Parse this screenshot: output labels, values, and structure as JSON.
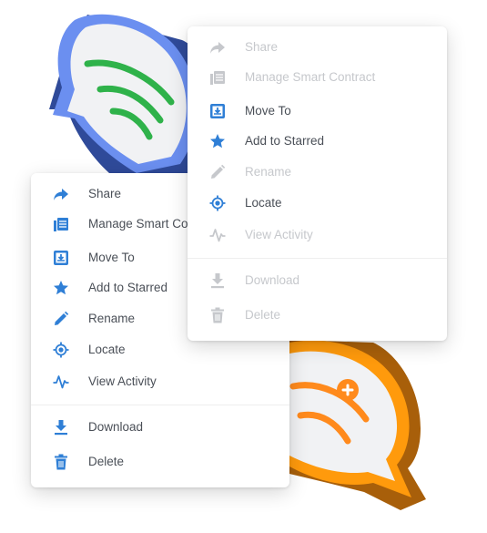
{
  "colors": {
    "accent": "#2f7fd6",
    "disabled": "#c6c8cc",
    "text": "#4a4f57",
    "bubble_blue": "#6b8ff0",
    "bubble_blue_dark": "#2f4a99",
    "bubble_orange": "#ff9a0c",
    "bubble_orange_dark": "#a85f0a",
    "wave_green": "#2fb24a",
    "wave_orange": "#ff8a1c"
  },
  "left_menu": {
    "items": [
      {
        "label": "Share",
        "icon": "share-icon",
        "enabled": true
      },
      {
        "label": "Manage Smart Contract",
        "icon": "contract-icon",
        "enabled": true
      },
      {
        "label": "Move To",
        "icon": "move-to-icon",
        "enabled": true
      },
      {
        "label": "Add to Starred",
        "icon": "star-icon",
        "enabled": true
      },
      {
        "label": "Rename",
        "icon": "pencil-icon",
        "enabled": true
      },
      {
        "label": "Locate",
        "icon": "locate-icon",
        "enabled": true
      },
      {
        "label": "View Activity",
        "icon": "activity-icon",
        "enabled": true
      },
      {
        "label": "Download",
        "icon": "download-icon",
        "enabled": true
      },
      {
        "label": "Delete",
        "icon": "trash-icon",
        "enabled": true
      }
    ]
  },
  "right_menu": {
    "items": [
      {
        "label": "Share",
        "icon": "share-icon",
        "enabled": false
      },
      {
        "label": "Manage Smart Contract",
        "icon": "contract-icon",
        "enabled": false
      },
      {
        "label": "Move To",
        "icon": "move-to-icon",
        "enabled": true
      },
      {
        "label": "Add to Starred",
        "icon": "star-icon",
        "enabled": true
      },
      {
        "label": "Rename",
        "icon": "pencil-icon",
        "enabled": false
      },
      {
        "label": "Locate",
        "icon": "locate-icon",
        "enabled": true
      },
      {
        "label": "View Activity",
        "icon": "activity-icon",
        "enabled": false
      },
      {
        "label": "Download",
        "icon": "download-icon",
        "enabled": false
      },
      {
        "label": "Delete",
        "icon": "trash-icon",
        "enabled": false
      }
    ]
  }
}
